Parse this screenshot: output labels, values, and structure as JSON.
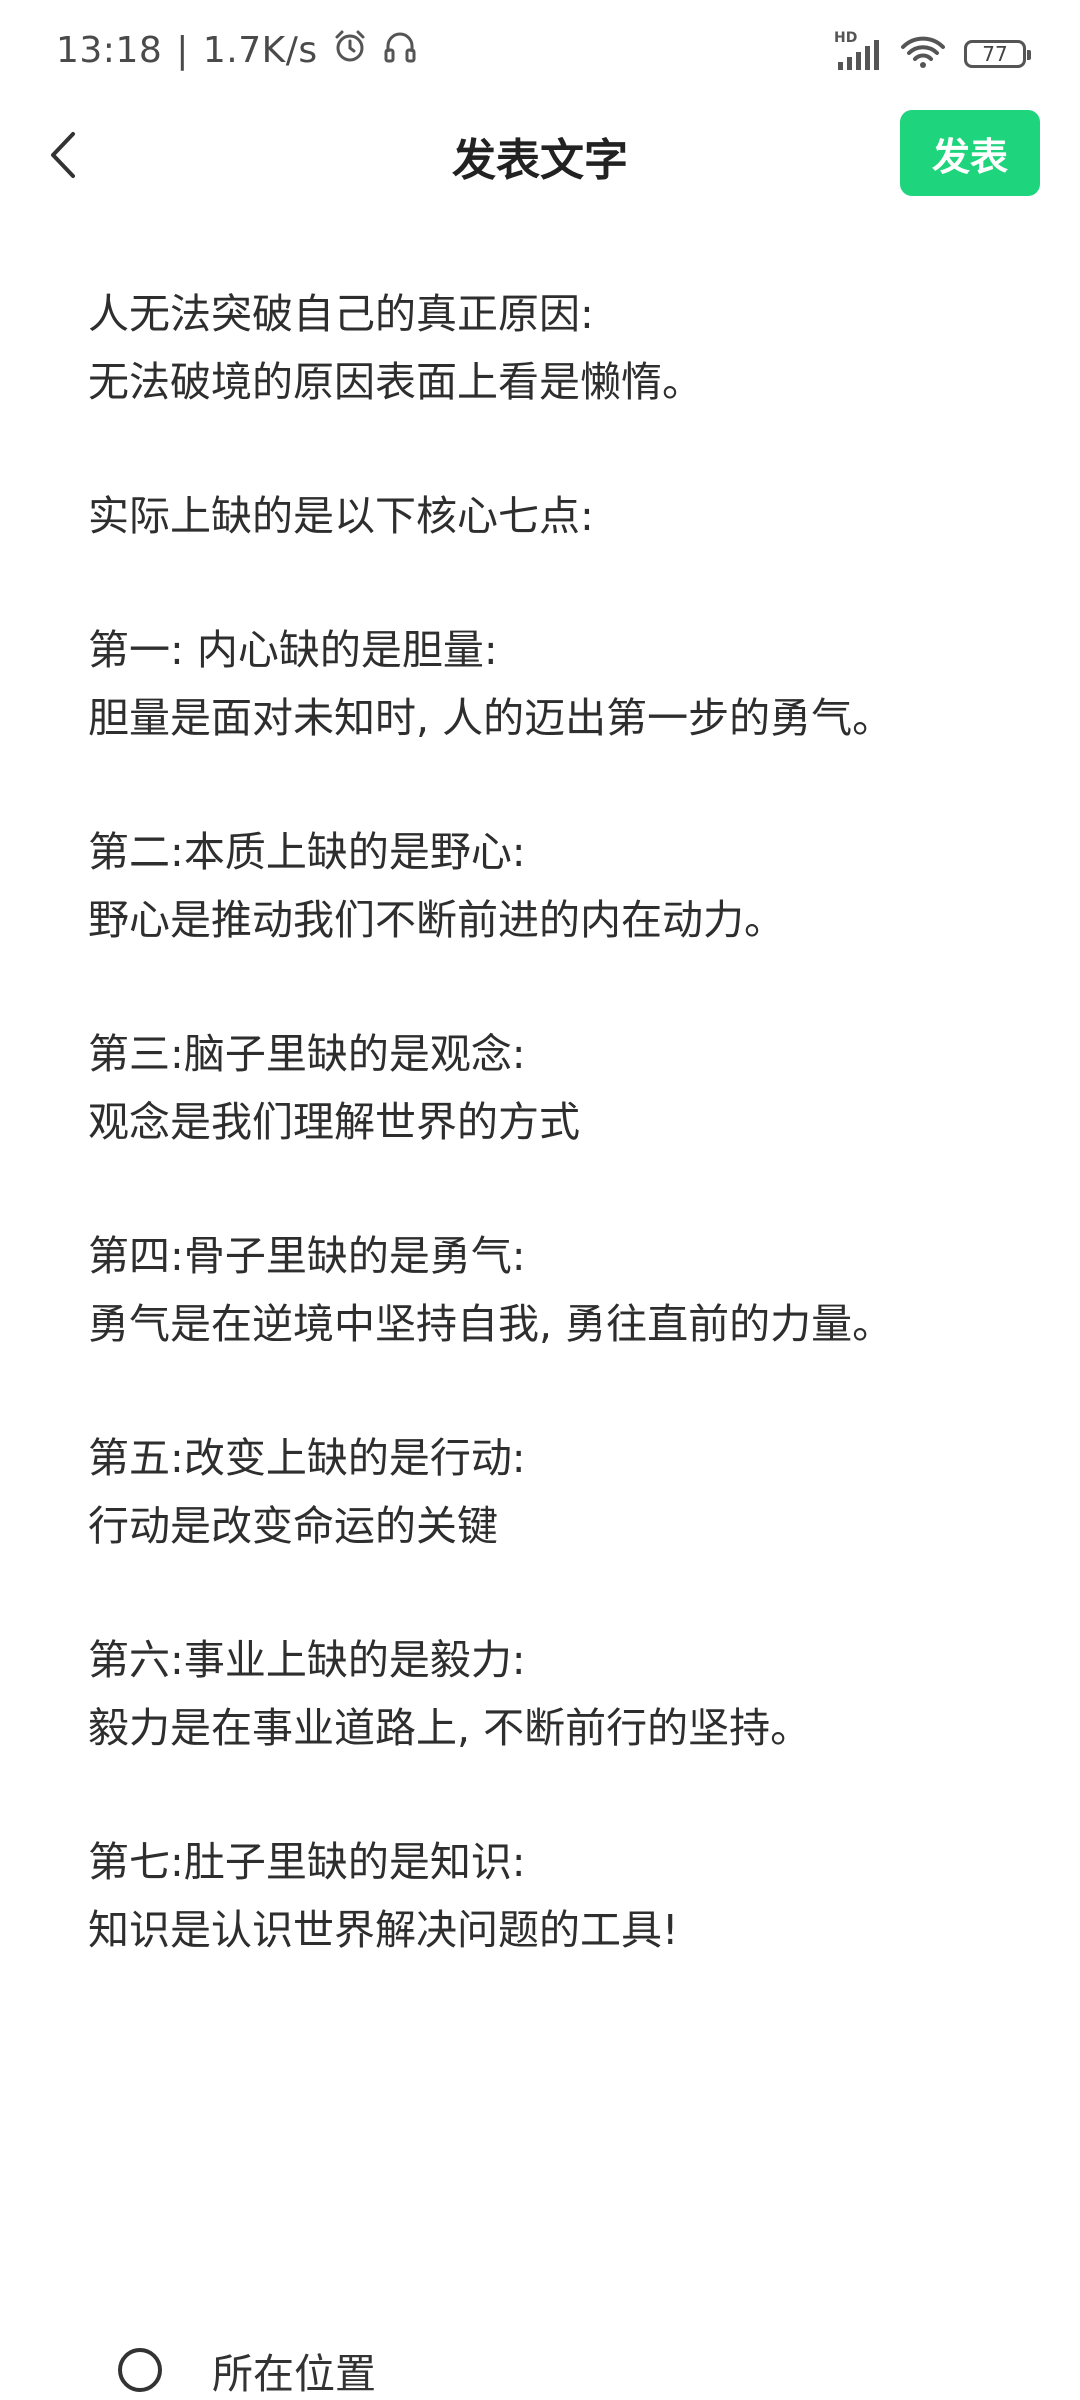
{
  "status_bar": {
    "time": "13:18",
    "separator": "|",
    "net_speed": "1.7K/s",
    "network_badge": "HD",
    "battery": "77",
    "icons": [
      "alarm-icon",
      "headset-icon",
      "signal-icon",
      "wifi-icon",
      "battery-icon"
    ]
  },
  "nav": {
    "back_icon": "chevron-left-icon",
    "title": "发表文字",
    "publish_label": "发表"
  },
  "colors": {
    "publish_green": "#1ed47c",
    "text": "#2e2e2e"
  },
  "editor": {
    "paragraphs": [
      [
        "人无法突破自己的真正原因:",
        "无法破境的原因表面上看是懒惰。"
      ],
      [
        "实际上缺的是以下核心七点:"
      ],
      [
        "第一: 内心缺的是胆量:",
        "胆量是面对未知时, 人的迈出第一步的勇气。"
      ],
      [
        "第二:本质上缺的是野心:",
        "野心是推动我们不断前进的内在动力。"
      ],
      [
        "第三:脑子里缺的是观念:",
        "观念是我们理解世界的方式"
      ],
      [
        "第四:骨子里缺的是勇气:",
        "勇气是在逆境中坚持自我, 勇往直前的力量。"
      ],
      [
        "第五:改变上缺的是行动:",
        "行动是改变命运的关键"
      ],
      [
        "第六:事业上缺的是毅力:",
        "毅力是在事业道路上, 不断前行的坚持。"
      ],
      [
        "第七:肚子里缺的是知识:",
        "知识是认识世界解决问题的工具!"
      ]
    ]
  },
  "location": {
    "icon": "location-icon",
    "label": "所在位置"
  }
}
